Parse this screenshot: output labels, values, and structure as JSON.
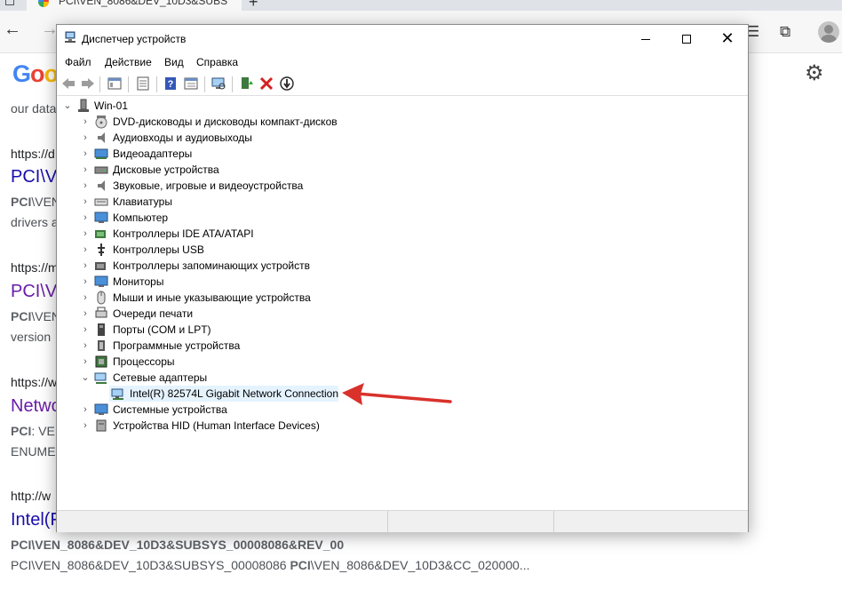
{
  "browser": {
    "tab_title": "PCI\\VEN_8086&DEV_10D3&SUBS",
    "page": {
      "line_our_data": "our data",
      "results": [
        {
          "url": "https://d",
          "title": "PCI\\V",
          "snippet_bold": "PCI",
          "snippet_rest": "\\VEN",
          "snippet2": "drivers a"
        },
        {
          "url": "https://m",
          "title": "PCI\\V",
          "snippet_bold": "PCI",
          "snippet_rest": "\\VEN",
          "snippet2": "version"
        },
        {
          "url": "https://w",
          "title": "Netwo",
          "snippet_bold": "PCI",
          "snippet_rest": ": VE",
          "snippet2": "ENUME"
        },
        {
          "url": "http://w",
          "title": "Intel(F"
        }
      ],
      "bold_line": "PCI\\VEN_8086&DEV_10D3&SUBSYS_00008086&REV_00",
      "last_line_a": "PCI\\VEN_8086&DEV_10D3&SUBSYS_00008086 ",
      "last_line_b": "PCI",
      "last_line_c": "\\VEN_8086&DEV_10D3&CC_020000..."
    }
  },
  "window": {
    "title": "Диспетчер устройств",
    "menu": [
      "Файл",
      "Действие",
      "Вид",
      "Справка"
    ],
    "root": "Win-01",
    "categories": [
      "DVD-дисководы и дисководы компакт-дисков",
      "Аудиовходы и аудиовыходы",
      "Видеоадаптеры",
      "Дисковые устройства",
      "Звуковые, игровые и видеоустройства",
      "Клавиатуры",
      "Компьютер",
      "Контроллеры IDE ATA/ATAPI",
      "Контроллеры USB",
      "Контроллеры запоминающих устройств",
      "Мониторы",
      "Мыши и иные указывающие устройства",
      "Очереди печати",
      "Порты (COM и LPT)",
      "Программные устройства",
      "Процессоры",
      "Сетевые адаптеры",
      "Системные устройства",
      "Устройства HID (Human Interface Devices)"
    ],
    "network_child": "Intel(R) 82574L Gigabit Network Connection"
  },
  "colors": {
    "accent_arrow": "#d9312b",
    "selection": "#e5f3ff"
  }
}
